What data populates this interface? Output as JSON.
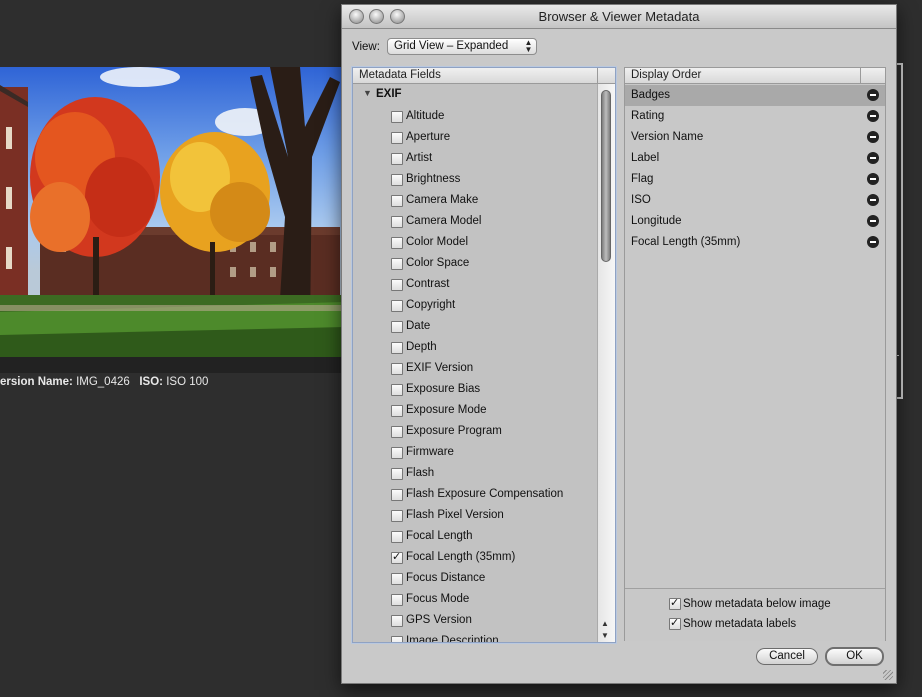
{
  "background": {
    "caption_fields": [
      {
        "label": "ersion Name:",
        "value": "IMG_0426"
      },
      {
        "label": "ISO:",
        "value": "ISO 100"
      }
    ]
  },
  "dialog": {
    "title": "Browser & Viewer Metadata",
    "view_label": "View:",
    "view_value": "Grid View – Expanded",
    "metadata_fields_header": "Metadata Fields",
    "group": "EXIF",
    "fields": [
      {
        "label": "Altitude",
        "checked": false
      },
      {
        "label": "Aperture",
        "checked": false
      },
      {
        "label": "Artist",
        "checked": false
      },
      {
        "label": "Brightness",
        "checked": false
      },
      {
        "label": "Camera Make",
        "checked": false
      },
      {
        "label": "Camera Model",
        "checked": false
      },
      {
        "label": "Color Model",
        "checked": false
      },
      {
        "label": "Color Space",
        "checked": false
      },
      {
        "label": "Contrast",
        "checked": false
      },
      {
        "label": "Copyright",
        "checked": false
      },
      {
        "label": "Date",
        "checked": false
      },
      {
        "label": "Depth",
        "checked": false
      },
      {
        "label": "EXIF Version",
        "checked": false
      },
      {
        "label": "Exposure Bias",
        "checked": false
      },
      {
        "label": "Exposure Mode",
        "checked": false
      },
      {
        "label": "Exposure Program",
        "checked": false
      },
      {
        "label": "Firmware",
        "checked": false
      },
      {
        "label": "Flash",
        "checked": false
      },
      {
        "label": "Flash Exposure Compensation",
        "checked": false
      },
      {
        "label": "Flash Pixel Version",
        "checked": false
      },
      {
        "label": "Focal Length",
        "checked": false
      },
      {
        "label": "Focal Length (35mm)",
        "checked": true
      },
      {
        "label": "Focus Distance",
        "checked": false
      },
      {
        "label": "Focus Mode",
        "checked": false
      },
      {
        "label": "GPS Version",
        "checked": false
      },
      {
        "label": "Image Description",
        "checked": false
      }
    ],
    "display_order_header": "Display Order",
    "display_order": [
      "Badges",
      "Rating",
      "Version Name",
      "Label",
      "Flag",
      "ISO",
      "Longitude",
      "Focal Length (35mm)"
    ],
    "selected_order_item": "Badges",
    "options": [
      {
        "label": "Show metadata below image",
        "checked": true
      },
      {
        "label": "Show metadata labels",
        "checked": true
      }
    ],
    "cancel_label": "Cancel",
    "ok_label": "OK"
  }
}
